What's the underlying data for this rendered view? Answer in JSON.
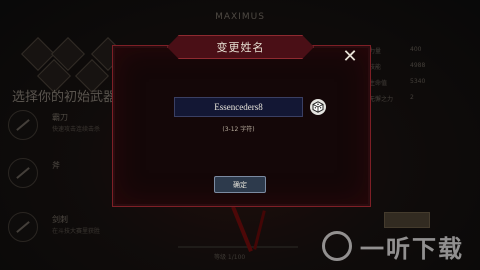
{
  "background": {
    "title": "MAXIMUS",
    "heading": "选择你的初始武器",
    "weapons": [
      {
        "name": "霸刀",
        "desc": "快速攻击连续击杀"
      },
      {
        "name": "斧",
        "desc": ""
      },
      {
        "name": "剑刺",
        "desc": "在斗技大赛里获胜"
      }
    ],
    "stats": [
      {
        "label": "力量",
        "value": "400",
        "color": "#9a8a60"
      },
      {
        "label": "技能",
        "value": "4988",
        "color": "#9a8a60"
      },
      {
        "label": "生命值",
        "value": "5340",
        "color": "#a23030"
      },
      {
        "label": "无懈之力",
        "value": "2",
        "color": "#5d6a8c"
      }
    ],
    "bottom_label": "等级 1/100"
  },
  "dialog": {
    "title": "变更姓名",
    "input_value": "Essenceders8",
    "hint": "(3-12 字符)",
    "confirm_label": "确定"
  },
  "watermark": {
    "text": "一听下载"
  }
}
